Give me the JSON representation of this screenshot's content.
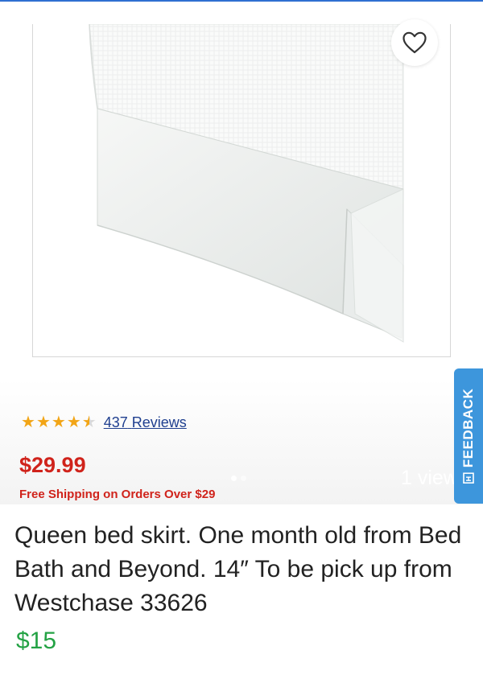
{
  "product": {
    "rating_stars": 4.5,
    "reviews_count": "437",
    "reviews_label": "Reviews",
    "price": "$29.99",
    "shipping": "Free Shipping on Orders Over $29"
  },
  "gallery": {
    "views": "1 view",
    "image_count": 2,
    "active_index": 0
  },
  "feedback": {
    "label": "FEEDBACK"
  },
  "listing": {
    "description": "Queen bed skirt.  One month old from Bed Bath and Beyond.  14″ To be pick up from Westchase 33626",
    "price": "$15"
  },
  "colors": {
    "price_red": "#d0231b",
    "star_gold": "#f2a516",
    "link_blue": "#1f3f8f",
    "feedback_blue": "#3d96dc",
    "listing_price_green": "#23a244"
  },
  "icons": [
    "heart-icon",
    "star-icon",
    "feedback-icon"
  ]
}
